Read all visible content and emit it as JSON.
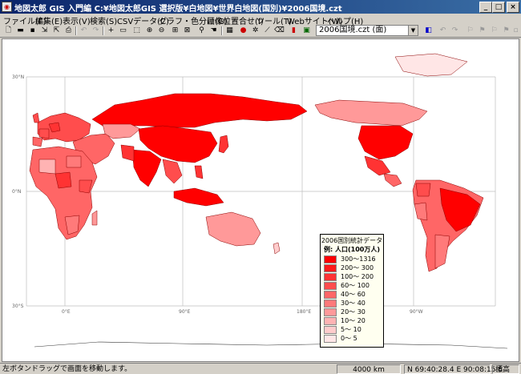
{
  "window": {
    "title": "地図太郎 GIS 入門編   C:¥地図太郎GIS 選択版¥白地図¥世界白地図(国別)¥2006国境.czt",
    "buttons": {
      "minimize": "_",
      "maximize": "□",
      "close": "×"
    }
  },
  "menu": [
    "ファイル(F)",
    "編集(E)",
    "表示(V)",
    "検索(S)",
    "CSVデータ(C)",
    "グラフ・色分け(G)",
    "画像位置合せ(I)",
    "ツール(T)",
    "Webサイト(W)",
    "ヘルプ(H)"
  ],
  "toolbar": {
    "layer_value": "2006国境.czt (面)",
    "icons": [
      "new-file-icon",
      "open-folder-icon",
      "save-icon",
      "import-icon",
      "export-icon",
      "print-icon",
      "undo-icon",
      "redo-icon",
      "add-point-icon",
      "edit-icon",
      "select-icon",
      "zoom-in-icon",
      "zoom-out-icon",
      "fit-extent-icon",
      "full-extent-icon",
      "find-icon",
      "pan-hand-icon",
      "table-icon",
      "record-icon",
      "snowflake-icon",
      "ruler-icon",
      "eraser-icon",
      "bar-chart-icon",
      "image-icon",
      "layer-dropdown",
      "layers-icon",
      "undo-2-icon",
      "redo-2-icon",
      "tool-a-icon",
      "tool-b-icon",
      "tool-c-icon",
      "tool-d-icon",
      "tool-e-icon"
    ]
  },
  "map": {
    "lat_labels": [
      "30°N",
      "0°N",
      "30°S"
    ],
    "lon_labels": [
      "0°E",
      "90°E",
      "180°E",
      "90°W"
    ],
    "colors": {
      "c300": "#ff0000",
      "c200": "#ff1a1a",
      "c100": "#ff3333",
      "c60": "#ff4d4d",
      "c40": "#ff6666",
      "c30": "#ff7a7a",
      "c20": "#ff9999",
      "c10": "#ffb3b3",
      "c5": "#ffcccc",
      "c0": "#ffe6e6"
    }
  },
  "legend": {
    "title": "2006国別統計データ",
    "subtitle": "例: 人口(100万人)",
    "classes": [
      {
        "label": "300～1316",
        "color": "#ff0000"
      },
      {
        "label": "200～ 300",
        "color": "#ff1a1a"
      },
      {
        "label": "100～ 200",
        "color": "#ff3333"
      },
      {
        "label": "60～ 100",
        "color": "#ff4d4d"
      },
      {
        "label": "40～  60",
        "color": "#ff6666"
      },
      {
        "label": "30～  40",
        "color": "#ff7a7a"
      },
      {
        "label": "20～  30",
        "color": "#ff9999"
      },
      {
        "label": "10～  20",
        "color": "#ffb3b3"
      },
      {
        "label": "5～  10",
        "color": "#ffcccc"
      },
      {
        "label": "0～   5",
        "color": "#ffe6e6"
      }
    ]
  },
  "status": {
    "hint": "左ボタンドラッグで画面を移動します。",
    "scale": "4000 km",
    "coords": "N 69:40:28.4  E 90:08:15.6",
    "elevation": "標高"
  }
}
